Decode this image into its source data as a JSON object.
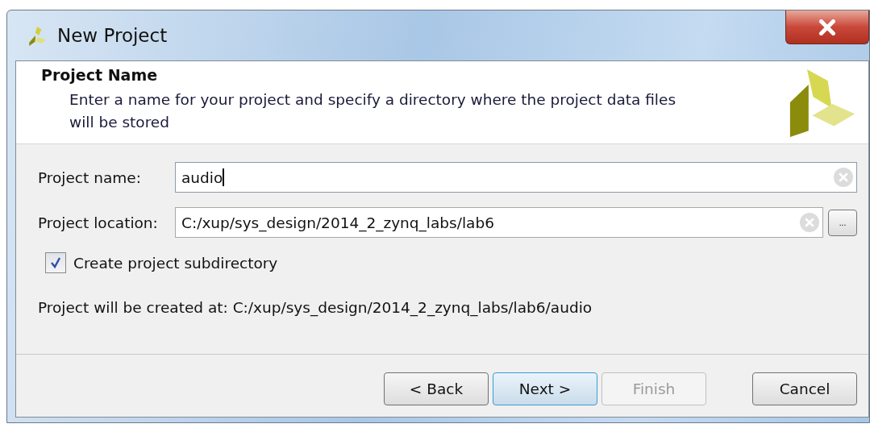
{
  "window": {
    "title": "New Project"
  },
  "header": {
    "title": "Project Name",
    "description": "Enter a name for your project and specify a directory where the project data files will be stored"
  },
  "fields": [
    {
      "kind": "text",
      "label": "Project name:",
      "value": "audio",
      "focused": true,
      "browse": false
    },
    {
      "kind": "text",
      "label": "Project location:",
      "value": "C:/xup/sys_design/2014_2_zynq_labs/lab6",
      "focused": false,
      "browse": true,
      "browse_label": "..."
    }
  ],
  "checkbox": {
    "label": "Create project subdirectory",
    "checked": true
  },
  "result": "Project will be created at: C:/xup/sys_design/2014_2_zynq_labs/lab6/audio",
  "buttons": [
    {
      "label": "< Back",
      "disabled": false,
      "default": false
    },
    {
      "label": "Next >",
      "disabled": false,
      "default": true
    },
    {
      "label": "Finish",
      "disabled": true,
      "default": false
    },
    {
      "label": "Cancel",
      "disabled": false,
      "default": false
    }
  ]
}
